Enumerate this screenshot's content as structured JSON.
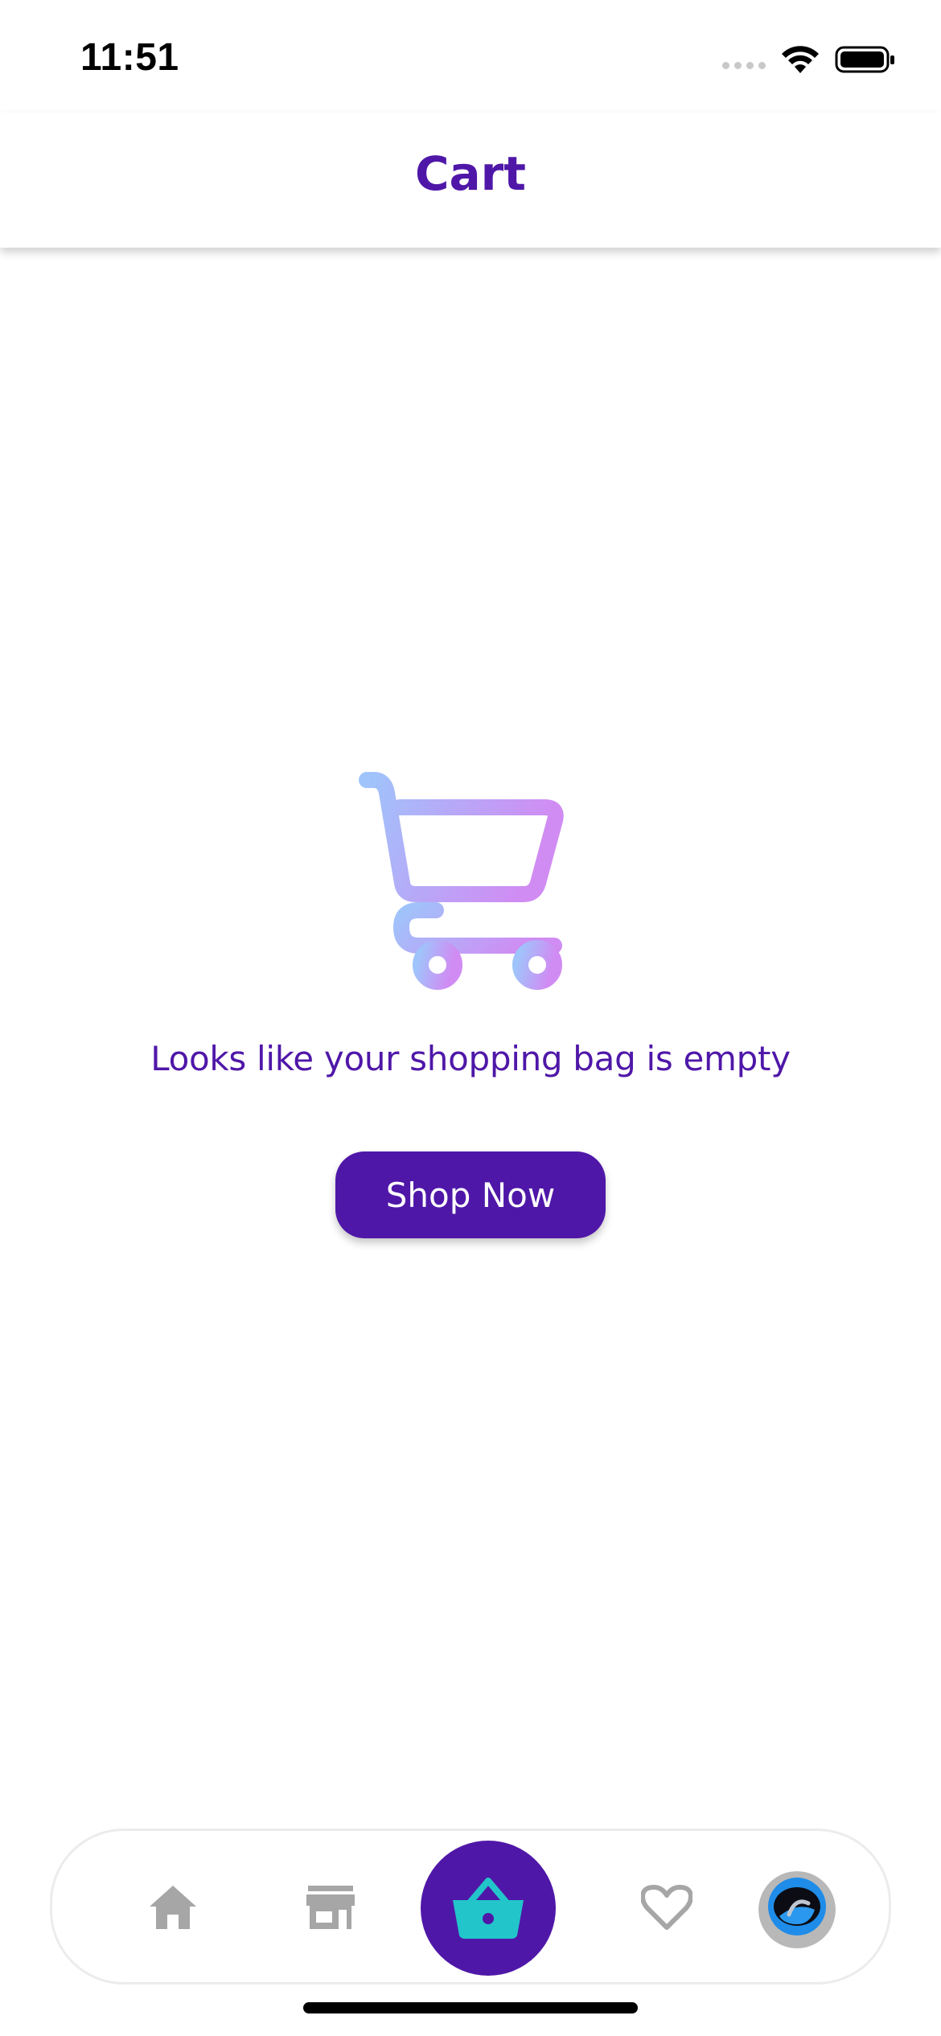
{
  "status_bar": {
    "time": "11:51",
    "icons": [
      "signal-icon",
      "wifi-icon",
      "battery-icon"
    ]
  },
  "header": {
    "title": "Cart"
  },
  "empty_state": {
    "illustration": "shopping-cart-icon",
    "message": "Looks like your shopping bag is empty",
    "button_label": "Shop Now"
  },
  "bottom_nav": {
    "items": [
      {
        "icon": "home-icon",
        "active": false
      },
      {
        "icon": "store-icon",
        "active": false
      },
      {
        "icon": "basket-icon",
        "active": true
      },
      {
        "icon": "heart-icon",
        "active": false
      },
      {
        "icon": "avatar",
        "active": false
      }
    ]
  },
  "colors": {
    "brand": "#4f17a8",
    "basket_accent": "#22c5c9",
    "inactive_icon": "#a6a6a6",
    "cart_gradient_start": "#9fc4fb",
    "cart_gradient_end": "#d08cf3"
  }
}
